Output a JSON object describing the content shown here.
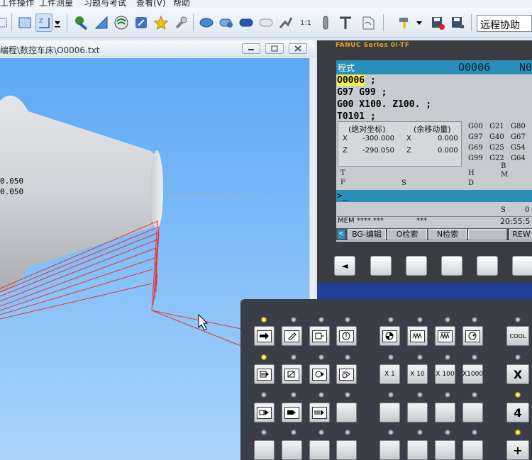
{
  "menu": {
    "items": [
      "工件操作",
      "工件测量",
      "习题与考试",
      "查看(V)",
      "帮助"
    ]
  },
  "toolbar": {
    "icons": [
      "select-rect-icon",
      "zoom-icon",
      "zoom-dropdown-icon",
      "tool-icon",
      "ruler-icon",
      "coolant-icon",
      "edit-icon",
      "star-icon",
      "wrench-icon",
      "workpiece-icon",
      "view-side-icon",
      "view-top-icon",
      "view-front-icon",
      "measure-icon",
      "one-to-one-icon",
      "tool-holder-icon",
      "tailstock-icon",
      "document-icon",
      "tool-dropdown-icon",
      "save-red-icon",
      "save-icon"
    ],
    "one_to_one_label": "1:1",
    "remote_label": "远程协助"
  },
  "viewport_window": {
    "title": "编程\\数控车床\\O0006.txt",
    "min_label": "▭",
    "restore_label": "▭",
    "close_label": "✕",
    "coord_1": "0.050",
    "coord_2": "0.050"
  },
  "cnc": {
    "brand": "FANUC Series 0i-TF",
    "mode": "程式",
    "program_no": "O0006",
    "program_no_right": "N0",
    "code_lines": [
      {
        "pre": "",
        "hl": "O0006",
        "post": " ;"
      },
      {
        "pre": "G97 G99 ;",
        "hl": "",
        "post": ""
      },
      {
        "pre": "G00 X100. Z100. ;",
        "hl": "",
        "post": ""
      },
      {
        "pre": "T0101 ;",
        "hl": "",
        "post": ""
      }
    ],
    "abs_label": "(绝对坐标)",
    "rem_label": "(余移动量)",
    "abs_x_axis": "X",
    "abs_x": "-300.000",
    "abs_z_axis": "Z",
    "abs_z": "-290.050",
    "rem_x_axis": "X",
    "rem_x": "0.000",
    "rem_z_axis": "Z",
    "rem_z": "0.000",
    "gcodes": [
      [
        "G00",
        "G21",
        "G80"
      ],
      [
        "G97",
        "G40",
        "G67"
      ],
      [
        "G69",
        "G25",
        "G54"
      ],
      [
        "G99",
        "G22",
        "G64"
      ]
    ],
    "label_B": "B",
    "label_T": "T",
    "label_H": "H",
    "label_M": "M",
    "label_F": "F",
    "label_S": "S",
    "label_D": "D",
    "prompt": ">_",
    "s_label": "S",
    "s_value": "0",
    "status_left": "MEM **** ***",
    "status_mid": "***",
    "clock": "20:55:5",
    "softkeys": [
      "BG-编辑",
      "O检索",
      "N检索",
      "",
      "REW"
    ],
    "softkey_left": "<",
    "hw_arrow": "◄"
  },
  "operator_panel": {
    "x1": "X  1",
    "x10": "X  10",
    "x100": "X 100",
    "x1000": "X1000",
    "cool": "COOL",
    "axis_x": "X",
    "num_4": "4",
    "plus": "+"
  }
}
